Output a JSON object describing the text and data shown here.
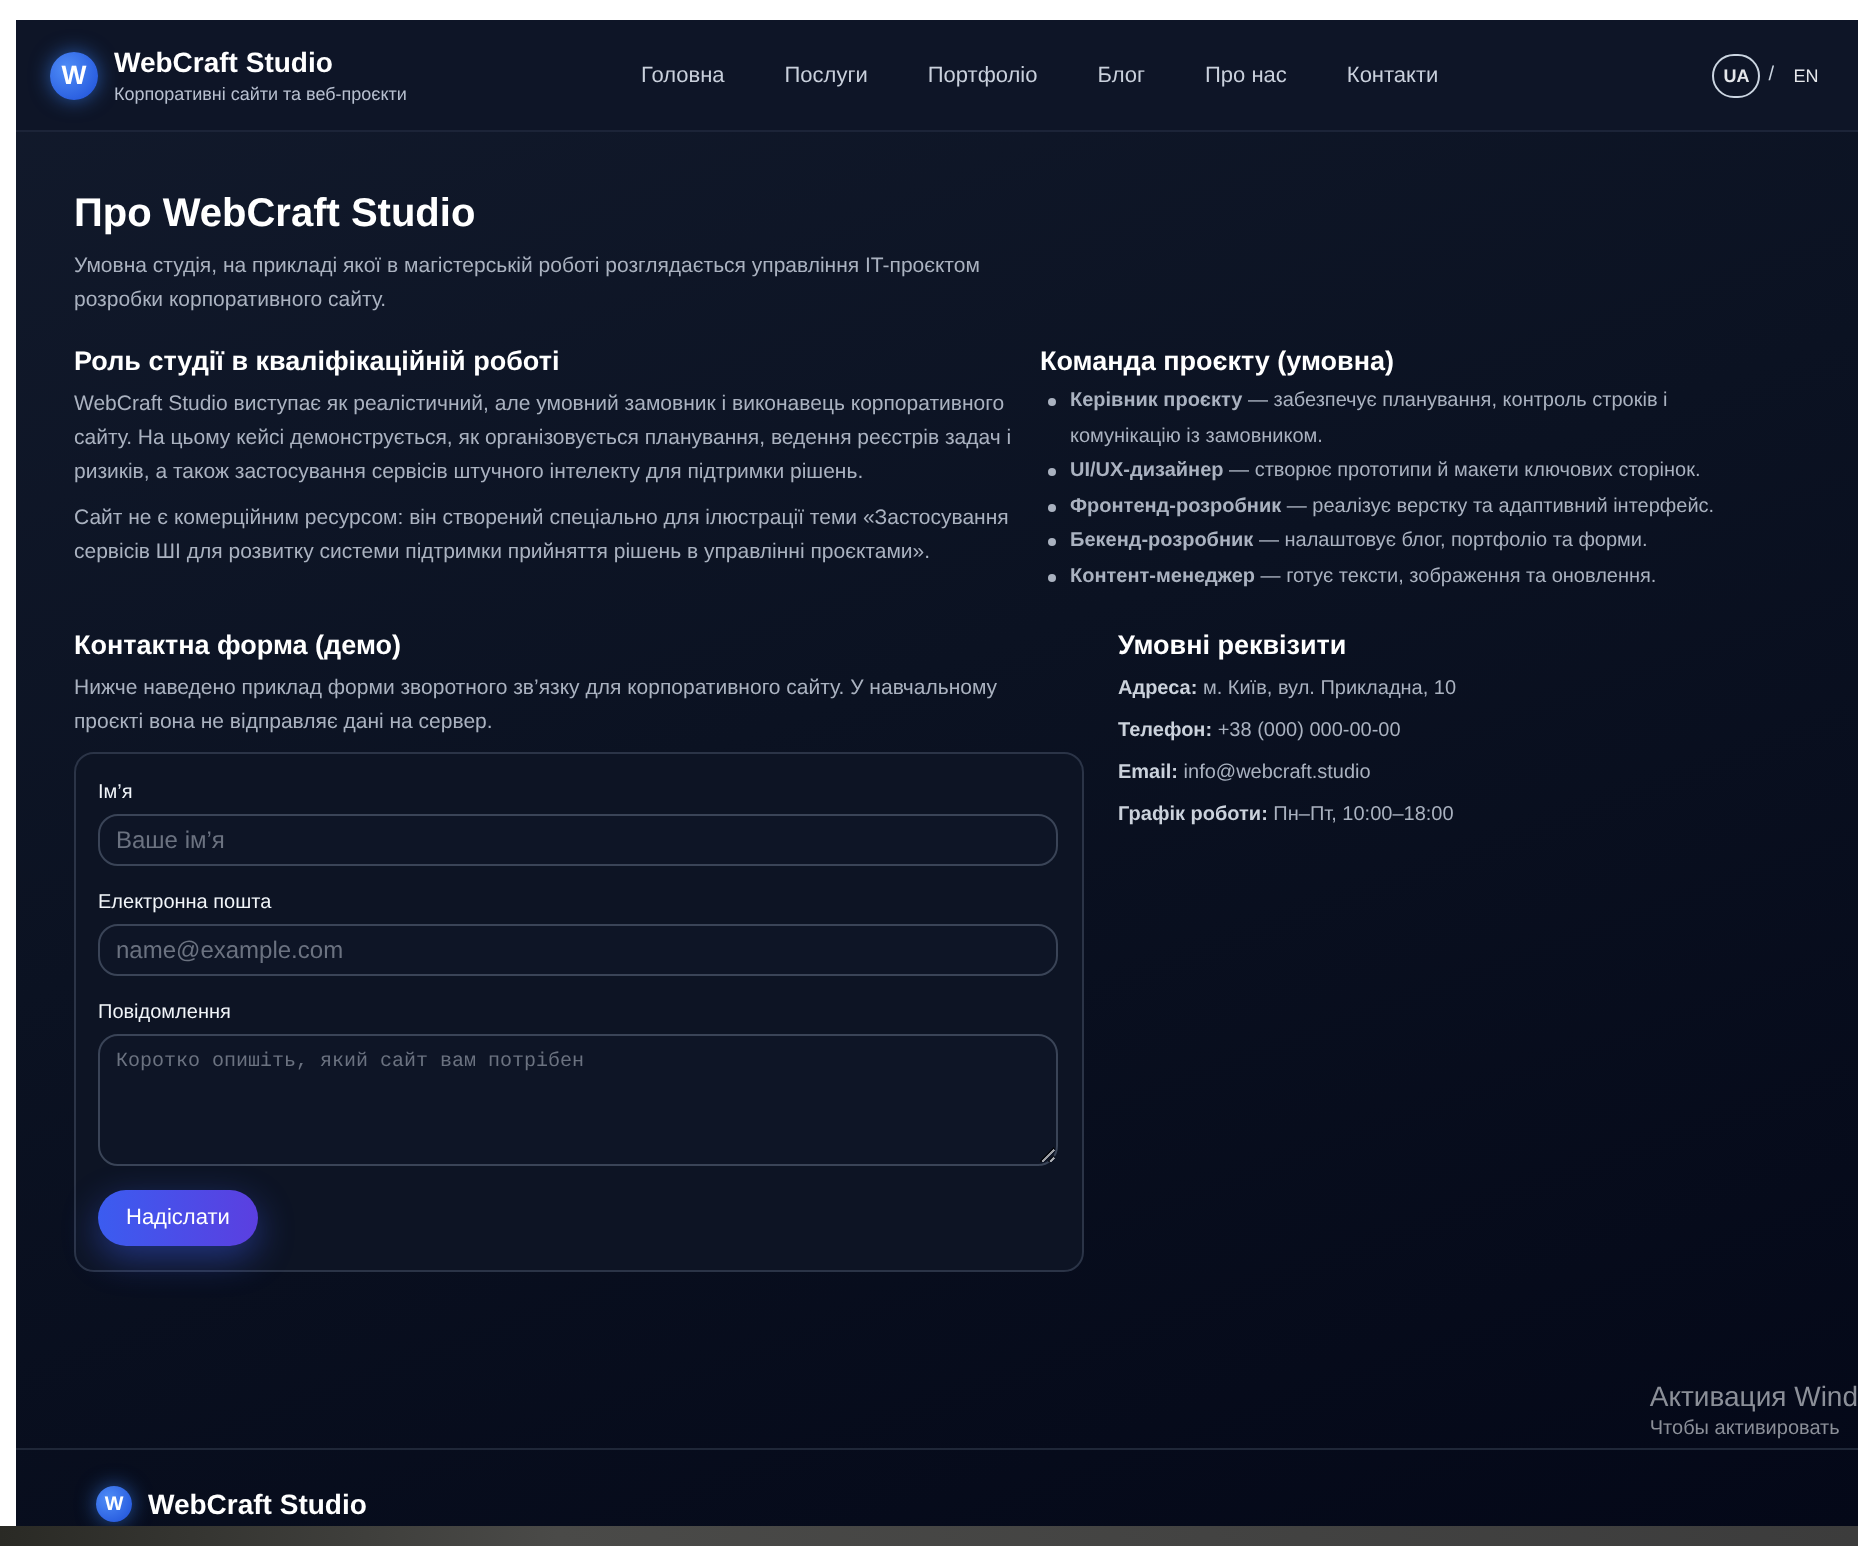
{
  "header": {
    "logo_letter": "W",
    "title": "WebCraft Studio",
    "subtitle": "Корпоративні сайти та веб-проєкти",
    "nav": [
      "Головна",
      "Послуги",
      "Портфоліо",
      "Блог",
      "Про нас",
      "Контакти"
    ],
    "languages": [
      {
        "label": "UA",
        "selected": true
      },
      {
        "label": "EN",
        "selected": false
      }
    ],
    "language_separator": "/"
  },
  "about": {
    "title": "Про WebCraft Studio",
    "intro": "Умовна студія, на прикладі якої в магістерській роботі розглядається управління IT-проєктом розробки корпоративного сайту."
  },
  "role": {
    "title": "Роль студії в кваліфікаційній роботі",
    "paragraphs": [
      "WebCraft Studio виступає як реалістичний, але умовний замовник і виконавець корпоративного сайту. На цьому кейсі демонструється, як організовується планування, ведення реєстрів задач і ризиків, а також застосування сервісів штучного інтелекту для підтримки рішень.",
      "Сайт не є комерційним ресурсом: він створений спеціально для ілюстрації теми «Застосування сервісів ШІ для розвитку системи підтримки прийняття рішень в управлінні проєктами»."
    ]
  },
  "team": {
    "title": "Команда проєкту (умовна)",
    "members": [
      "**Керівник проєкту** — забезпечує планування, контроль строків і комунікацію із замовником.",
      "**UI/UX-дизайнер** — створює прототипи й макети ключових сторінок.",
      "**Фронтенд-розробник** — реалізує верстку та адаптивний інтерфейс.",
      "**Бекенд-розробник** — налаштовує блог, портфоліо та форми.",
      "**Контент-менеджер** — готує тексти, зображення та оновлення."
    ]
  },
  "contact_form": {
    "title": "Контактна форма (демо)",
    "description": "Нижче наведено приклад форми зворотного зв’язку для корпоративного сайту. У навчальному проєкті вона не відправляє дані на сервер.",
    "fields": [
      {
        "kind": "text",
        "label": "Ім’я",
        "placeholder": "Ваше ім’я"
      },
      {
        "kind": "text",
        "label": "Електронна пошта",
        "placeholder": "name@example.com"
      },
      {
        "kind": "textarea",
        "label": "Повідомлення",
        "placeholder": "Коротко опишіть, який сайт вам потрібен"
      }
    ],
    "submit": "Надіслати"
  },
  "details": {
    "title": "Умовні реквізити",
    "lines": [
      "**Адреса:** м. Київ, вул. Прикладна, 10",
      "**Телефон:** +38 (000) 000-00-00",
      "**Email:** info@webcraft.studio",
      "**Графік роботи:** Пн–Пт, 10:00–18:00"
    ]
  },
  "os_notice": [
    "Активация Wind",
    "Чтобы активировать"
  ],
  "footer": {
    "logo_letter": "W",
    "title": "WebCraft Studio"
  }
}
